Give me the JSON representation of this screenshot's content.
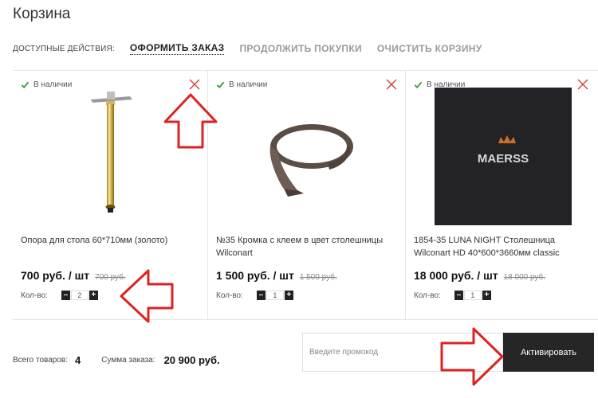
{
  "page": {
    "title": "Корзина"
  },
  "actions": {
    "label": "ДОСТУПНЫЕ ДЕЙСТВИЯ:",
    "checkout": "ОФОРМИТЬ ЗАКАЗ",
    "continue": "ПРОДОЛЖИТЬ ПОКУПКИ",
    "clear": "ОЧИСТИТЬ КОРЗИНУ"
  },
  "colors": {
    "accent": "#dd3333",
    "dark": "#262626",
    "stock_check": "#3a9a3a"
  },
  "products": [
    {
      "stock": "В наличии",
      "name": "Опора для стола 60*710мм (золото)",
      "price": "700 руб. / шт",
      "old_price": "700 руб.",
      "qty_label": "Кол-во:",
      "qty": "2",
      "icon": "table-leg-image"
    },
    {
      "stock": "В наличии",
      "name": "№35 Кромка с клеем в цвет столешницы Wilconart",
      "price": "1 500 руб. / шт",
      "old_price": "1 500 руб.",
      "qty_label": "Кол-во:",
      "qty": "1",
      "icon": "edge-band-roll-image"
    },
    {
      "stock": "В наличии",
      "name": "1854-35 LUNA NIGHT Столешница Wilconart HD 40*600*3660мм classic",
      "price": "18 000 руб. / шт",
      "old_price": "18 000 руб.",
      "qty_label": "Кол-во:",
      "qty": "1",
      "icon": "countertop-image",
      "brand_logo": "MAERSS"
    }
  ],
  "stepper": {
    "minus": "–",
    "plus": "+"
  },
  "summary": {
    "items_label": "Всего товаров:",
    "items_count": "4",
    "sum_label": "Сумма заказа:",
    "sum_value": "20 900 руб."
  },
  "promo": {
    "placeholder": "Введите промокод",
    "button": "Активировать"
  }
}
